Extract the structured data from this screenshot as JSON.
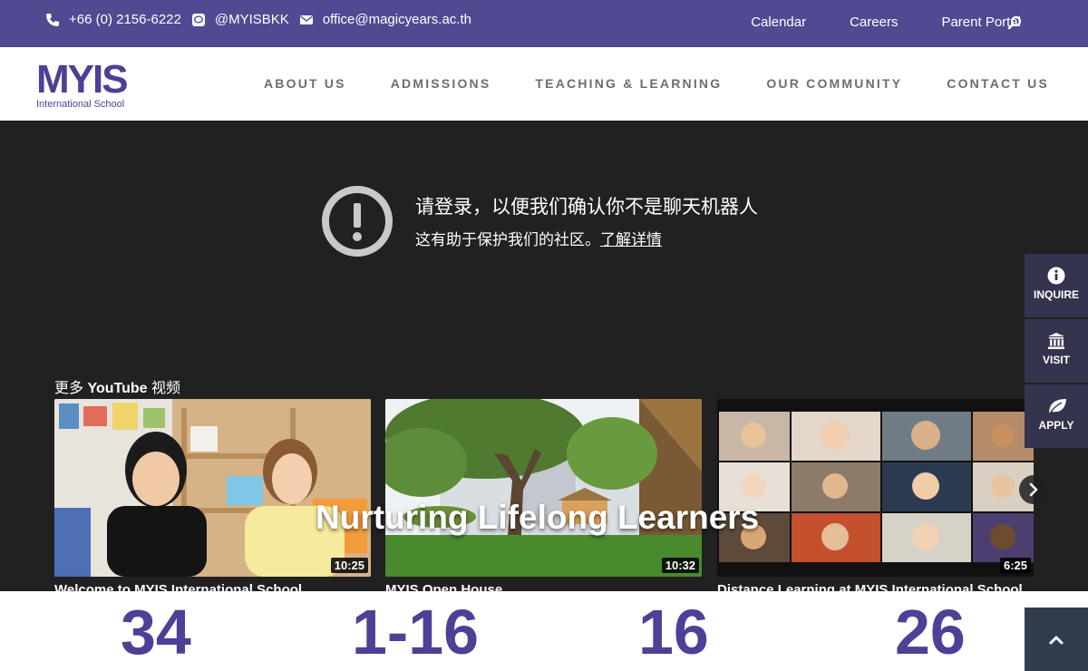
{
  "topbar": {
    "phone": "+66 (0) 2156-6222",
    "line": "@MYISBKK",
    "email": "office@magicyears.ac.th",
    "links": [
      "Calendar",
      "Careers",
      "Parent Portal"
    ]
  },
  "header": {
    "logo_word": "MYIS",
    "logo_sub": "International School",
    "nav": [
      "ABOUT US",
      "ADMISSIONS",
      "TEACHING & LEARNING",
      "OUR COMMUNITY",
      "CONTACT US"
    ]
  },
  "video": {
    "signin_title": "请登录，以便我们确认你不是聊天机器人",
    "signin_sub": "这有助于保护我们的社区。",
    "signin_link": "了解详情",
    "more_prefix": "更多 ",
    "more_brand": "YouTube",
    "more_suffix": " 视频",
    "tagline": "Nurturing Lifelong Learners",
    "thumbnails": [
      {
        "title": "Welcome to MYIS International School",
        "duration": "10:25"
      },
      {
        "title": "MYIS Open House",
        "duration": "10:32"
      },
      {
        "title": "Distance Learning at MYIS International School",
        "duration": "6:25"
      }
    ]
  },
  "side_tabs": [
    {
      "label": "INQUIRE",
      "icon": "info-icon"
    },
    {
      "label": "VISIT",
      "icon": "building-icon"
    },
    {
      "label": "APPLY",
      "icon": "leaf-icon"
    }
  ],
  "stats": [
    "34",
    "1-16",
    "16",
    "26"
  ],
  "colors": {
    "brand": "#4f4a92",
    "logo": "#4f3f97",
    "video_bg": "#212121",
    "side_tab": "#34344f"
  }
}
